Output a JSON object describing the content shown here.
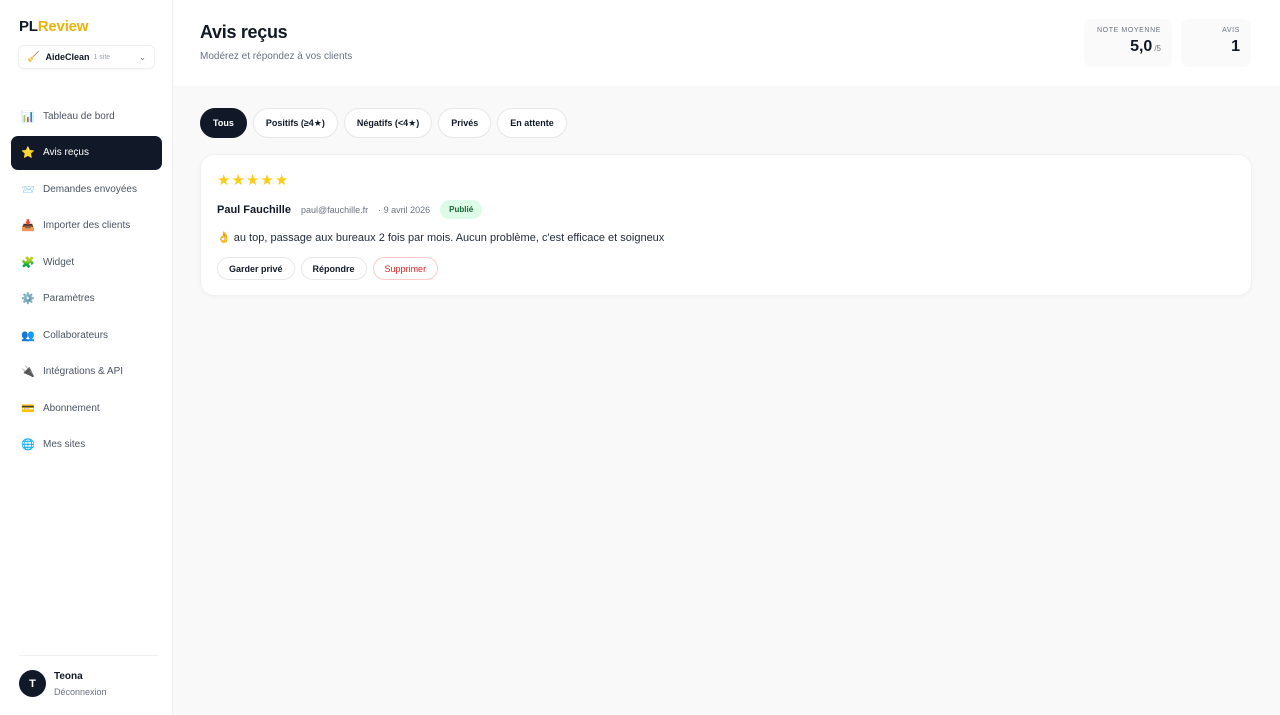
{
  "brand": {
    "pl": "PL",
    "review": "Review"
  },
  "site_selector": {
    "icon": "broom-icon",
    "name": "AideClean",
    "count": "1 site"
  },
  "nav": [
    {
      "icon": "📊",
      "label": "Tableau de bord"
    },
    {
      "icon": "⭐",
      "label": "Avis reçus",
      "active": true
    },
    {
      "icon": "📨",
      "label": "Demandes envoyées"
    },
    {
      "icon": "📥",
      "label": "Importer des clients"
    },
    {
      "icon": "🧩",
      "label": "Widget"
    },
    {
      "icon": "⚙️",
      "label": "Paramètres"
    },
    {
      "icon": "👥",
      "label": "Collaborateurs"
    },
    {
      "icon": "🔌",
      "label": "Intégrations & API"
    },
    {
      "icon": "💳",
      "label": "Abonnement"
    },
    {
      "icon": "🌐",
      "label": "Mes sites"
    }
  ],
  "user": {
    "initial": "T",
    "name": "Teona",
    "logout": "Déconnexion"
  },
  "header": {
    "title": "Avis reçus",
    "subtitle": "Modérez et répondez à vos clients"
  },
  "stats": {
    "rating": {
      "label": "NOTE MOYENNE",
      "value": "5,0",
      "unit": "/5"
    },
    "count": {
      "label": "AVIS",
      "value": "1"
    }
  },
  "filters": [
    "Tous",
    "Positifs (≥4★)",
    "Négatifs (<4★)",
    "Privés",
    "En attente"
  ],
  "review": {
    "stars": 5,
    "author": "Paul Fauchille",
    "email": "paul@fauchille.fr",
    "date": "· 9 avril 2026",
    "status": "Publié",
    "text": "👌 au top, passage aux bureaux 2 fois par mois. Aucun problème, c'est efficace et soigneux",
    "actions": {
      "private": "Garder privé",
      "reply": "Répondre",
      "delete": "Supprimer"
    }
  },
  "colors": {
    "accent": "#111827",
    "brand_yellow": "#eab308",
    "star": "#facc15",
    "danger": "#dc2626",
    "success_bg": "#dcfce7"
  }
}
